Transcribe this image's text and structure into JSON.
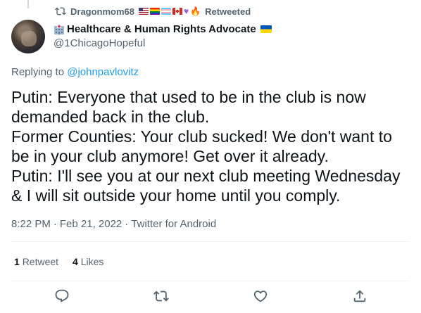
{
  "retweet_banner": {
    "user": "Dragonmom68",
    "label": "Retweeted"
  },
  "author": {
    "name": "Healthcare & Human Rights Advocate",
    "handle": "@1ChicagoHopeful"
  },
  "reply": {
    "prefix": "Replying to",
    "mention": "@johnpavlovitz"
  },
  "tweet": {
    "lines": [
      "Putin: Everyone that used to be in the club is now",
      "demanded back in the club.",
      "Former Counties: Your club sucked! We don't want to",
      "be in your club anymore! Get over it already.",
      "Putin: I'll see you at our next club meeting Wednesday",
      "& I will sit outside your home until you comply."
    ]
  },
  "meta": {
    "time": "8:22 PM",
    "sep1": "·",
    "date": "Feb 21, 2022",
    "sep2": "·",
    "source": "Twitter for Android"
  },
  "stats": {
    "retweets_count": "1",
    "retweets_label": "Retweet",
    "likes_count": "4",
    "likes_label": "Likes"
  },
  "icons": {
    "retweet_banner": "retweet-icon",
    "reply": "reply-icon",
    "retweet": "retweet-icon",
    "like": "heart-icon",
    "share": "share-icon",
    "name_prefix": "hospital-icon",
    "name_suffix": "ukraine-flag-icon"
  },
  "colors": {
    "link": "#1d9bf0",
    "secondary_text": "#536471",
    "primary_text": "#0f1419"
  }
}
